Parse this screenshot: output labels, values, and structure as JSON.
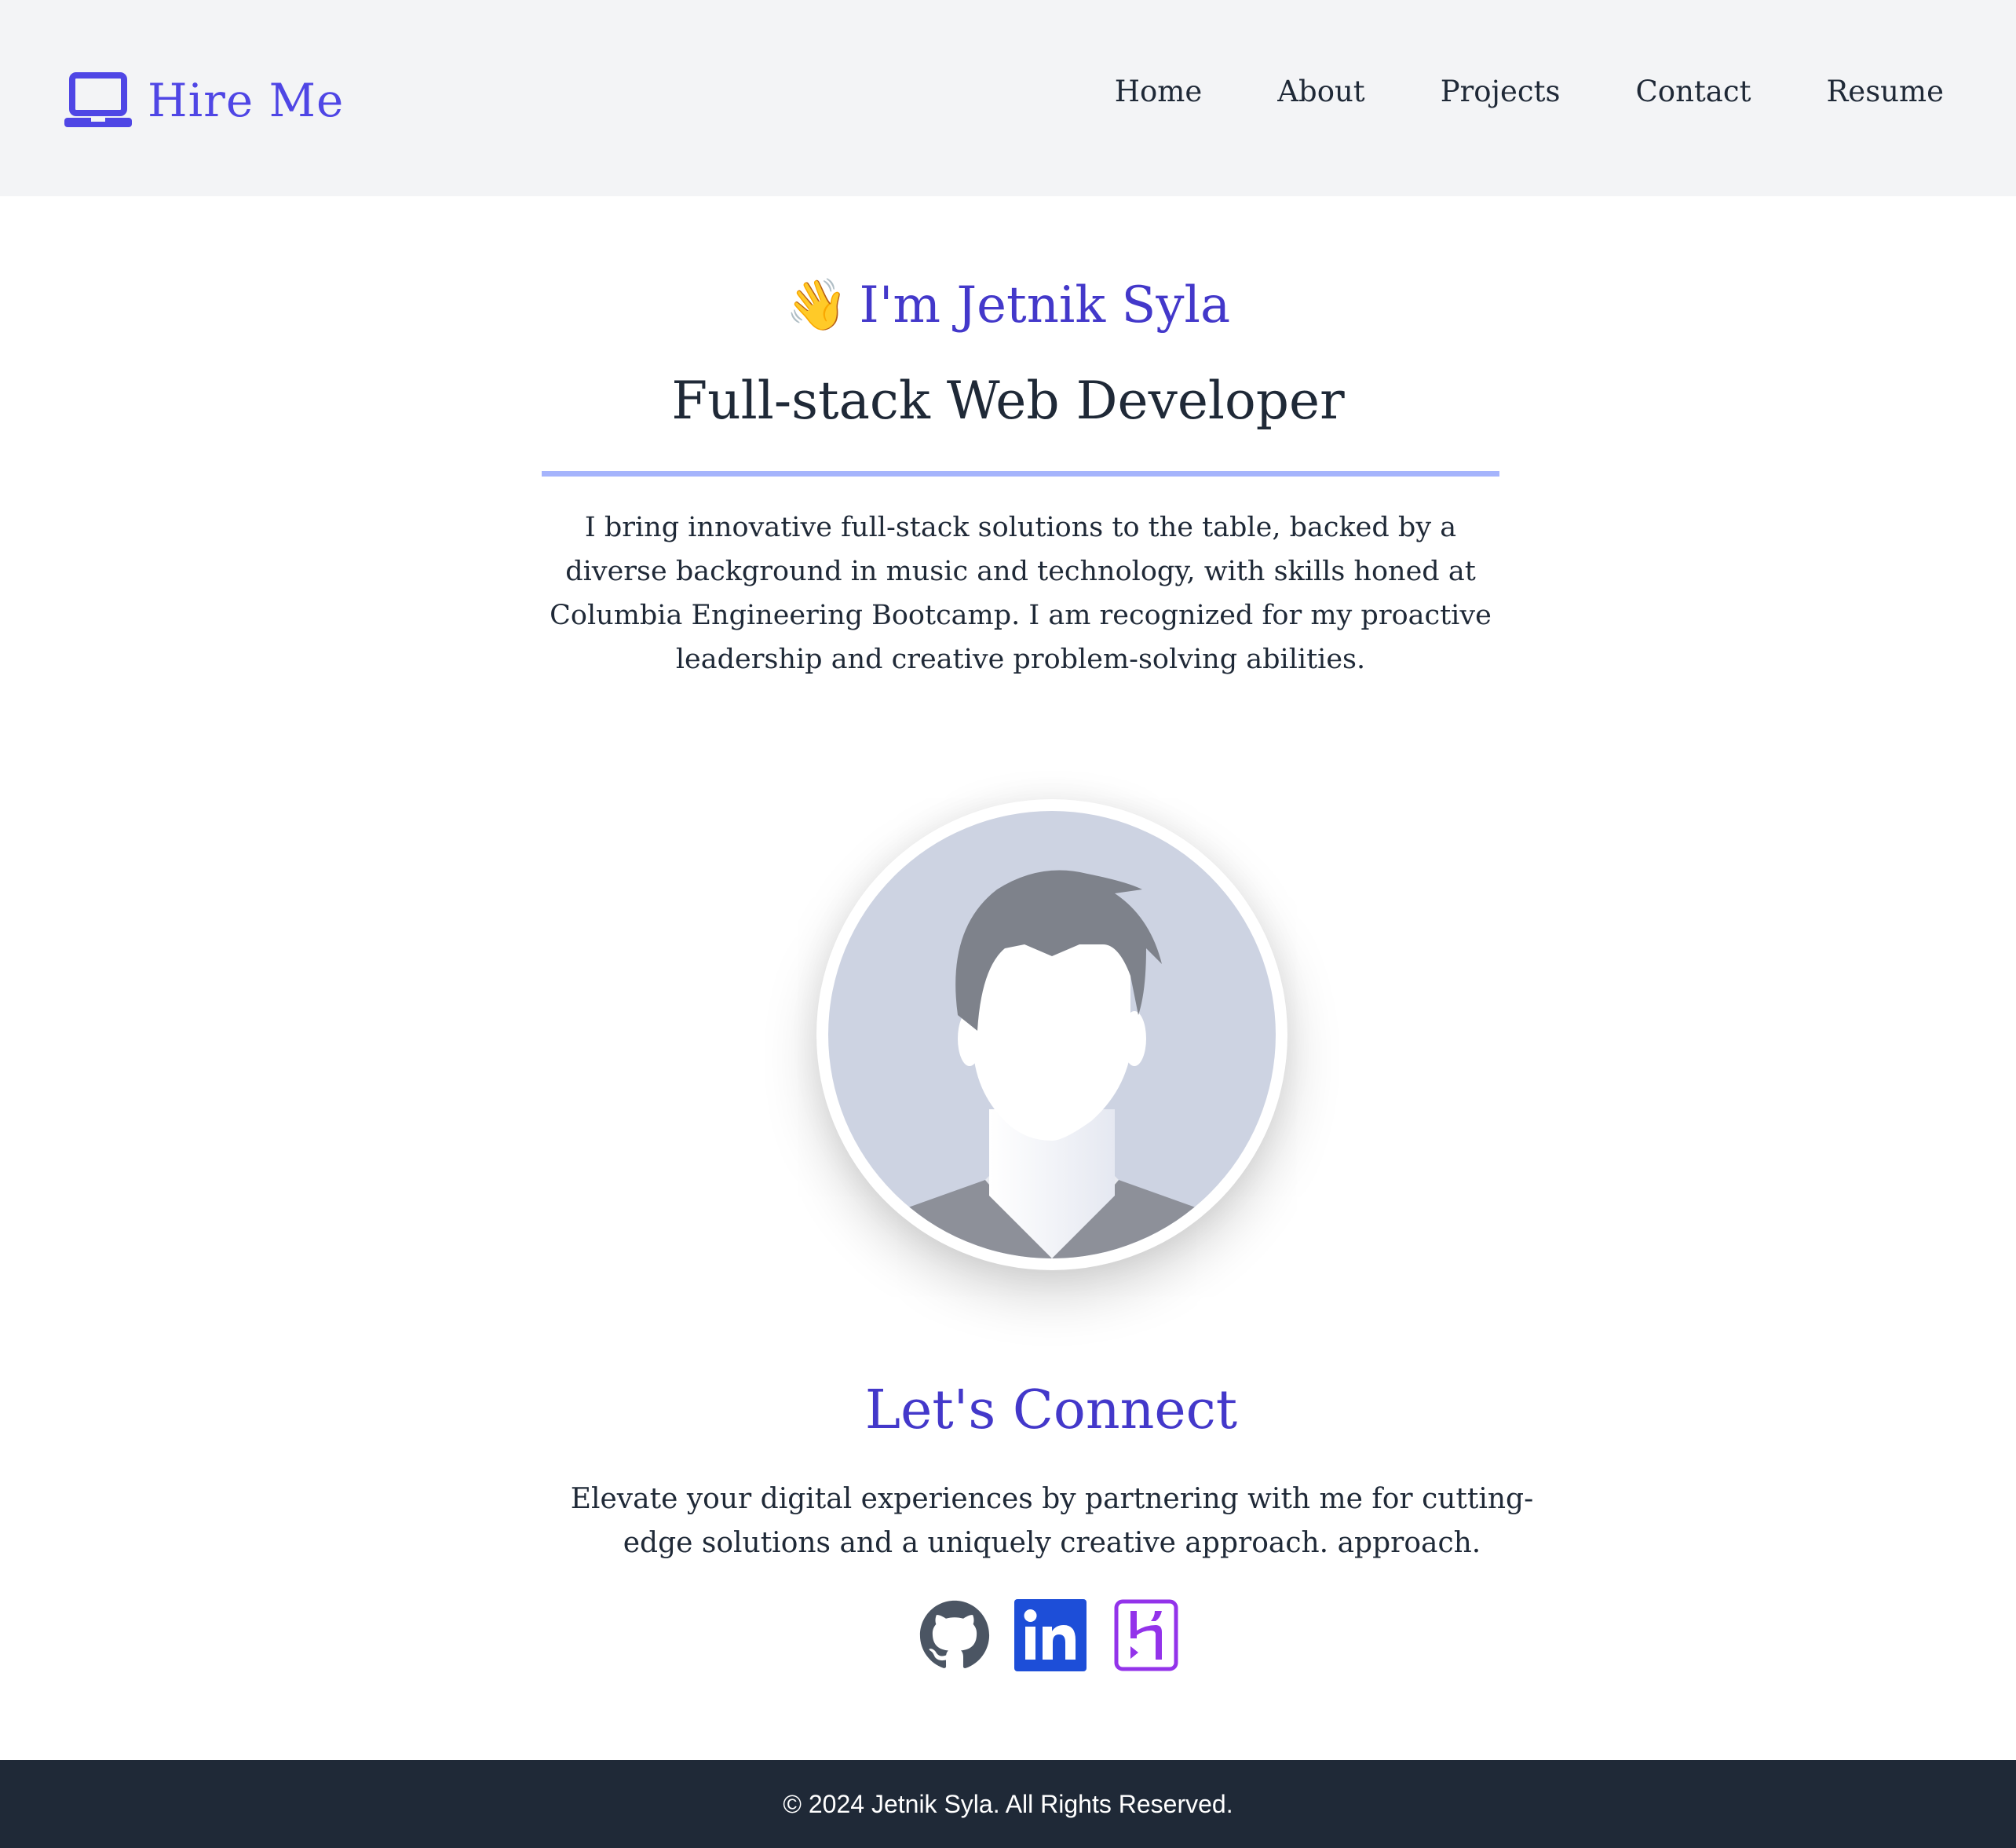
{
  "header": {
    "brand": "Hire Me",
    "nav": [
      "Home",
      "About",
      "Projects",
      "Contact",
      "Resume"
    ]
  },
  "hero": {
    "wave": "👋",
    "name": "I'm Jetnik Syla",
    "role": "Full-stack Web Developer",
    "bio": "I bring innovative full-stack solutions to the table, backed by a diverse background in music and technology, with skills honed at Columbia Engineering Bootcamp. I am recognized for my proactive leadership and creative problem-solving abilities."
  },
  "connect": {
    "title": "Let's Connect",
    "text": "Elevate your digital experiences by partnering with me for cutting-edge solutions and a uniquely creative approach. approach.",
    "socials": [
      "github-icon",
      "linkedin-icon",
      "heroku-icon"
    ]
  },
  "footer": {
    "text": "© 2024 Jetnik Syla. All Rights Reserved."
  },
  "colors": {
    "accent": "#4f46e5",
    "accent_dark": "#4338ca",
    "divider": "#a5b4fc",
    "header_bg": "#f3f4f6",
    "footer_bg": "#1f2937"
  }
}
